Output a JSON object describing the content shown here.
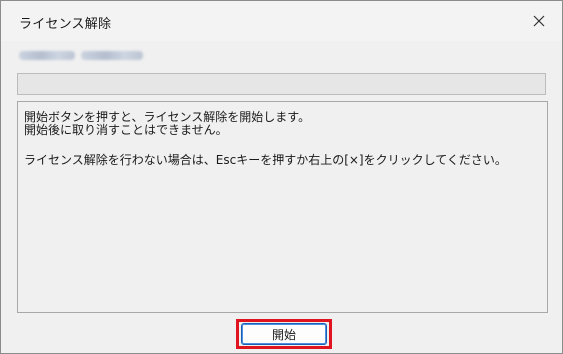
{
  "window": {
    "title": "ライセンス解除"
  },
  "icons": {
    "close": "close-icon"
  },
  "progress": {
    "value": 0
  },
  "message": {
    "line1": "開始ボタンを押すと、ライセンス解除を開始します。",
    "line2": "開始後に取り消すことはできません。",
    "line3": "ライセンス解除を行わない場合は、Escキーを押すか右上の[×]をクリックしてください。"
  },
  "buttons": {
    "start_label": "開始"
  },
  "colors": {
    "highlight": "#e0141e",
    "button_border": "#1a5fb4"
  }
}
